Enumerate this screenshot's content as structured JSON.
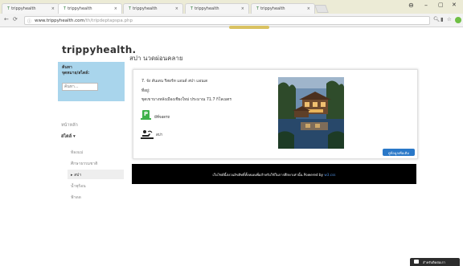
{
  "browser": {
    "tabs": [
      {
        "label": "trippyhealth",
        "active": false
      },
      {
        "label": "trippyhealth",
        "active": true
      },
      {
        "label": "trippyhealth",
        "active": false
      },
      {
        "label": "trippyhealth",
        "active": false
      },
      {
        "label": "trippyhealth",
        "active": false
      },
      {
        "label": "trippyhealth",
        "active": false
      }
    ],
    "tab_close": "×",
    "tab_favicon": "T",
    "url_host": "www.trippyhealth.com",
    "url_path": "/th/tripdeptapspa.php",
    "window_controls": {
      "account": "⊖",
      "minimize": "–",
      "maximize": "▢",
      "close": "✕"
    }
  },
  "site": {
    "logo": "trippyhealth."
  },
  "search": {
    "label_line1": "ค้นหา",
    "label_line2": "จุดหมาย/สไตล์:",
    "placeholder": "ค้นหา..."
  },
  "nav": {
    "home": "หน้าหลัก",
    "style": "สไตล์ ▾",
    "items": [
      {
        "label": "ท้องแม่",
        "active": false
      },
      {
        "label": "ศึกษาธรรมชาติ",
        "active": false
      },
      {
        "label": "▸  สปา",
        "active": true
      },
      {
        "label": "น้ำพุร้อน",
        "active": false
      },
      {
        "label": "ฟ้าดด",
        "active": false
      }
    ]
  },
  "main": {
    "title": "สปา นวดผ่อนคลาย",
    "card": {
      "name": "7. จัง สันเดน รีสอร์ท แอนด์ สปา แอนเด",
      "address_label": "ที่อยู่:",
      "address": "ขุดเขาบางหลังเมืองเชียงใหม่ ประมาณ 71.7 กิโลเมตร",
      "amenities": [
        {
          "icon": "parking-icon",
          "label": "มีที่จอดรถ"
        },
        {
          "icon": "massage-icon",
          "label": "สปา"
        }
      ],
      "more_button": "ดูข้อมูลเพิ่มเติม"
    }
  },
  "footer": {
    "text": "เว็บไซต์นี้สงวนลิขสิทธิ์ทั้งหมดเพื่อสำหรับใช้ในการศึกษาเท่านั้น Powered by ",
    "link": "w3.css"
  },
  "chat": {
    "label": "สำหรับติดต่อเรา"
  },
  "colors": {
    "tabbar": "#ecebd6",
    "search_panel": "#a9d5ec",
    "footer": "#000000",
    "button": "#2a78c8",
    "parking": "#3db14a"
  }
}
